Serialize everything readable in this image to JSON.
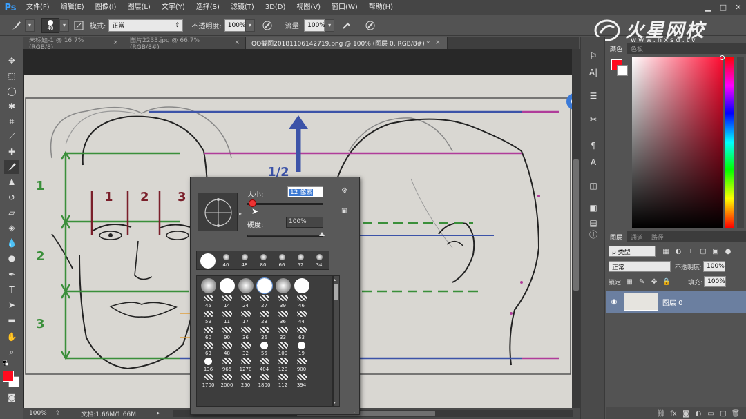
{
  "app": {
    "logo": "Ps"
  },
  "menu": [
    "文件(F)",
    "编辑(E)",
    "图像(I)",
    "图层(L)",
    "文字(Y)",
    "选择(S)",
    "滤镜(T)",
    "3D(D)",
    "视图(V)",
    "窗口(W)",
    "帮助(H)"
  ],
  "window_controls": {
    "minimize": "▁",
    "maximize": "□",
    "close": "✕"
  },
  "options": {
    "brush_size": "40",
    "mode_label": "模式:",
    "mode_value": "正常",
    "opacity_label": "不透明度:",
    "opacity_value": "100%",
    "flow_label": "流量:",
    "flow_value": "100%"
  },
  "watermark": {
    "title": "火星网校",
    "url": "www.hxsd.tv"
  },
  "tabs": [
    {
      "label": "未标题-1 @ 16.7%(RGB/8)",
      "close": "×"
    },
    {
      "label": "图片2233.jpg @ 66.7%(RGB/8#)",
      "close": "×"
    },
    {
      "label": "QQ截图20181106142719.png @ 100% (图层 0, RGB/8#) *",
      "close": "×"
    }
  ],
  "canvas_labels": {
    "row1": "1",
    "row2": "2",
    "row3": "3",
    "col1": "1",
    "col2": "2",
    "col3": "3",
    "half": "1/2"
  },
  "status": {
    "zoom": "100%",
    "doc": "文档:1.66M/1.66M"
  },
  "color_panel": {
    "tabs": [
      "颜色",
      "色板"
    ],
    "fg_color": "#ff0a1e",
    "bg_color": "#ffffff"
  },
  "layers_panel": {
    "tabs": [
      "图层",
      "通道",
      "路径"
    ],
    "filter_label": "ρ 类型",
    "blend_mode": "正常",
    "opacity_label": "不透明度:",
    "opacity_value": "100%",
    "lock_label": "锁定:",
    "fill_label": "填充:",
    "fill_value": "100%",
    "layer_name": "图层 0"
  },
  "brush_popup": {
    "size_label": "大小:",
    "size_value": "12 像素",
    "hardness_label": "硬度:",
    "hardness_value": "100%",
    "recent_sizes": [
      "40",
      "48",
      "80",
      "66",
      "52",
      "34"
    ],
    "grid_rows": [
      [
        "",
        "",
        "",
        "",
        "",
        ""
      ],
      [
        "45",
        "14",
        "24",
        "27",
        "39",
        "46"
      ],
      [
        "59",
        "11",
        "17",
        "23",
        "36",
        "44"
      ],
      [
        "60",
        "90",
        "36",
        "36",
        "33",
        "63"
      ],
      [
        "63",
        "48",
        "32",
        "55",
        "100",
        "19"
      ],
      [
        "136",
        "965",
        "1278",
        "404",
        "120",
        "900"
      ],
      [
        "1700",
        "2000",
        "250",
        "1800",
        "112",
        "394"
      ]
    ]
  }
}
